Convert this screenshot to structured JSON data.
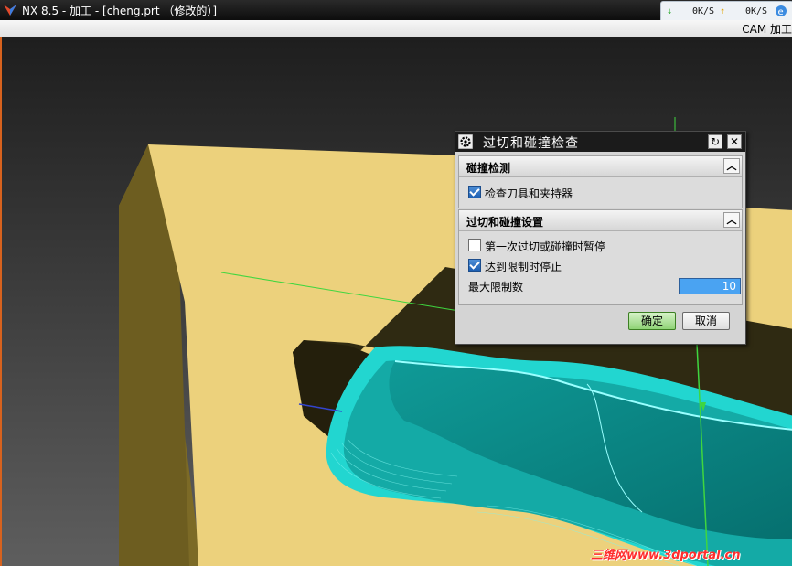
{
  "window": {
    "title": "NX 8.5 - 加工 - [cheng.prt （修改的）]"
  },
  "netmon": {
    "down": "0K/S",
    "up": "0K/S"
  },
  "menubar": {
    "right_label": "CAM 加工"
  },
  "dialog": {
    "title": "过切和碰撞检查",
    "group1": {
      "title": "碰撞检测",
      "check_tool_holder": {
        "label": "检查刀具和夹持器",
        "checked": true
      }
    },
    "group2": {
      "title": "过切和碰撞设置",
      "pause_first": {
        "label": "第一次过切或碰撞时暂停",
        "checked": false
      },
      "stop_at_limit": {
        "label": "达到限制时停止",
        "checked": true
      },
      "max_limit": {
        "label": "最大限制数",
        "value": "10"
      }
    },
    "ok_label": "确定",
    "cancel_label": "取消"
  },
  "watermark": "三维网www.3dportal.cn",
  "colors": {
    "part_face": "#ecd17c",
    "toolpath": "#1ee0d8",
    "floor": "#0c8c8a",
    "ok_button": "#8fd376"
  }
}
